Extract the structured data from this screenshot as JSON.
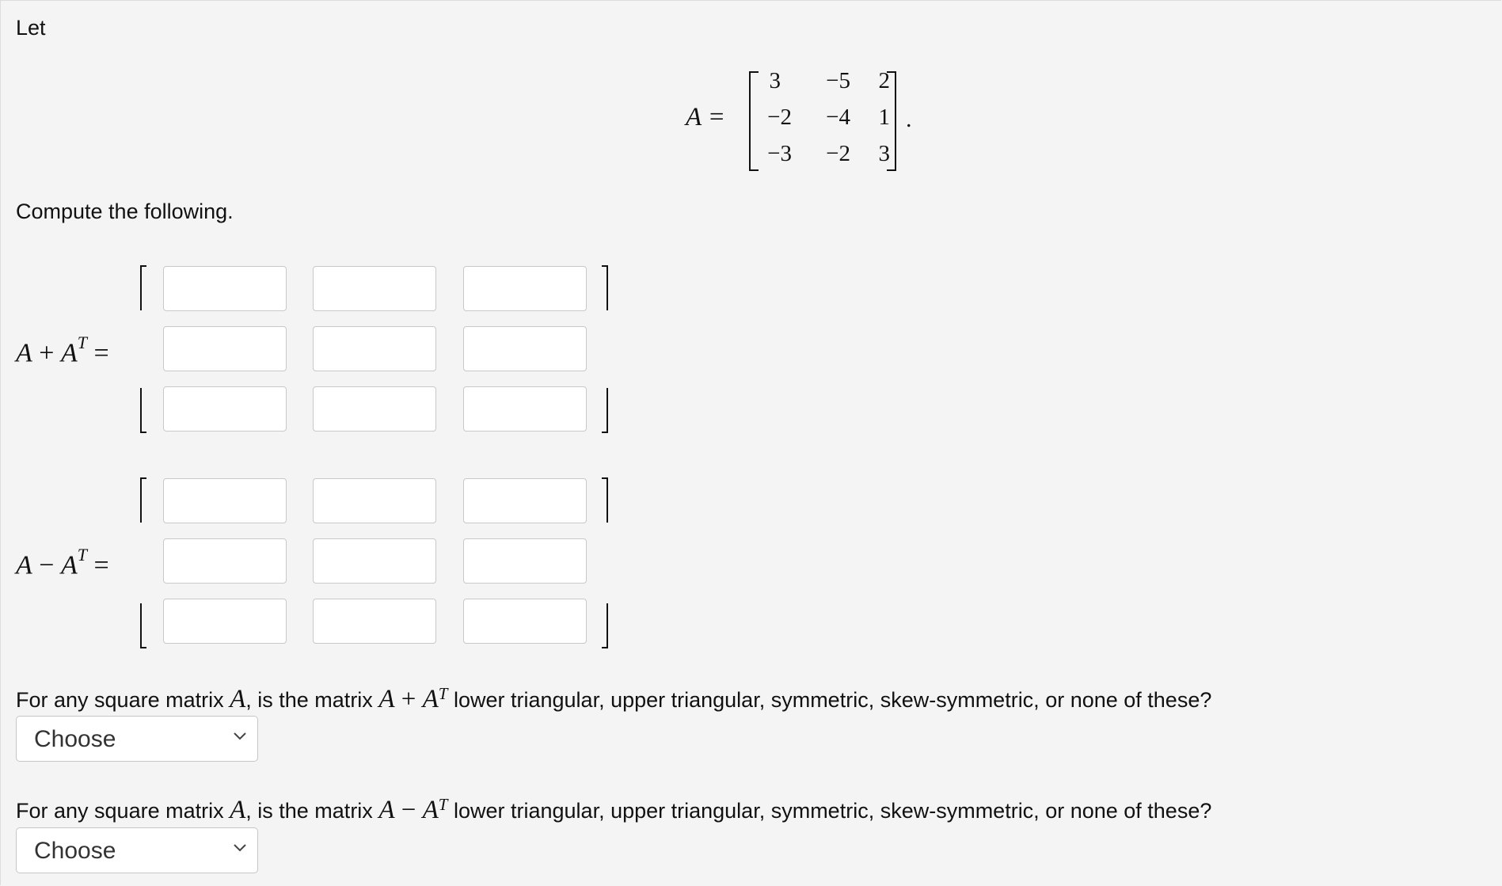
{
  "intro": "Let",
  "given": {
    "lhs": "A =",
    "rows": [
      [
        "3",
        "−5",
        "2"
      ],
      [
        "−2",
        "−4",
        "1"
      ],
      [
        "−3",
        "−2",
        "3"
      ]
    ],
    "end": "."
  },
  "prompt": "Compute the following.",
  "sum_label": {
    "a": "A",
    "op": "+",
    "a2": "A",
    "sup": "T",
    "eq": "="
  },
  "diff_label": {
    "a": "A",
    "op": "−",
    "a2": "A",
    "sup": "T",
    "eq": "="
  },
  "q1": {
    "pre": "For any square matrix ",
    "var": "A",
    "mid": ", is the matrix ",
    "expr_a": "A",
    "expr_op": " + ",
    "expr_b": "A",
    "sup": "T",
    "post": " lower triangular, upper triangular, symmetric, skew-symmetric, or none of these?",
    "select_value": "Choose"
  },
  "q2": {
    "pre": "For any square matrix ",
    "var": "A",
    "mid": ", is the matrix ",
    "expr_a": "A",
    "expr_op": " − ",
    "expr_b": "A",
    "sup": "T",
    "post": " lower triangular, upper triangular, symmetric, skew-symmetric, or none of these?",
    "select_value": "Choose"
  },
  "icons": {
    "dropdown": "chevron-down-icon"
  }
}
